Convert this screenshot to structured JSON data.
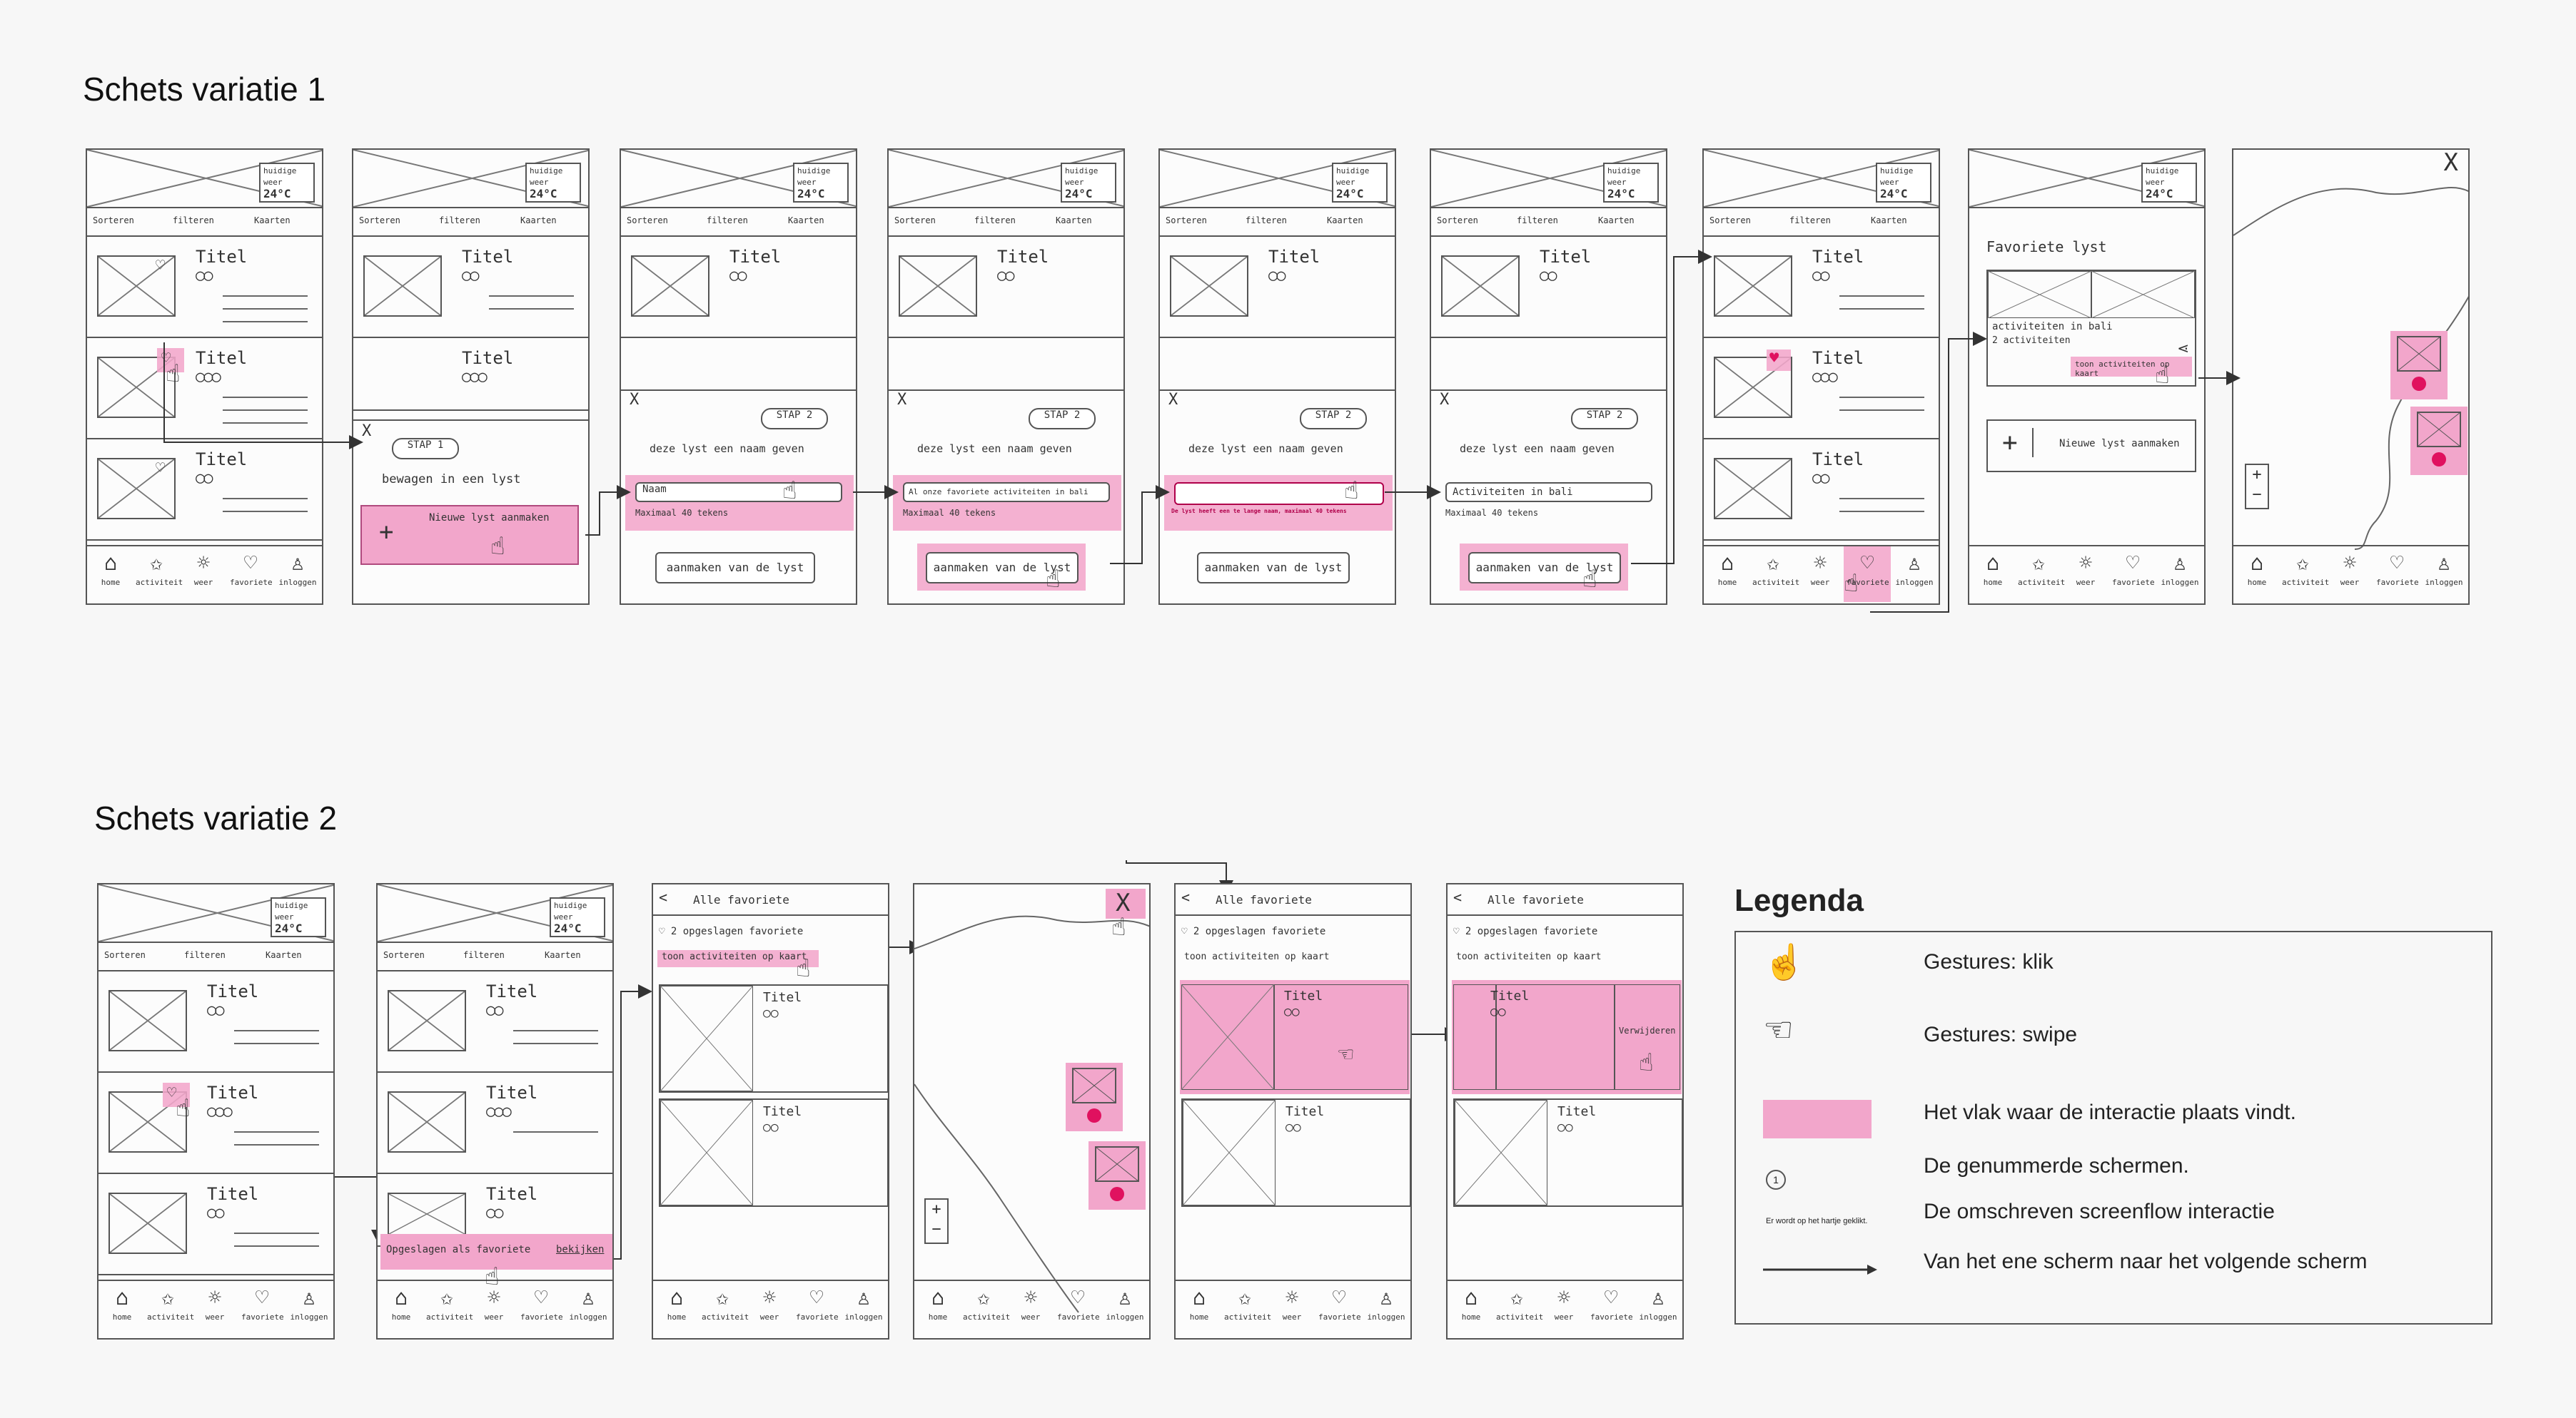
{
  "titles": {
    "variatie1": "Schets variatie 1",
    "variatie2": "Schets variatie 2"
  },
  "common": {
    "weather_label": "huidige weer",
    "weather_temp": "24°C",
    "filter_sort": "Sorteren",
    "filter_filter": "filteren",
    "filter_map": "Kaarten",
    "card_title": "Titel",
    "nav_home": "home",
    "nav_activiteit": "activiteit",
    "nav_weer": "weer",
    "nav_favoriete": "favoriete",
    "nav_inloggen": "inloggen",
    "close": "X",
    "back": "<"
  },
  "v1": {
    "s2_step": "STAP 1",
    "s2_heading": "bewagen in een lyst",
    "s2_new_list": "Nieuwe lyst aanmaken",
    "s3_step": "STAP 2",
    "s3_heading": "deze lyst een naam geven",
    "s3_field": "Naam",
    "s3_hint": "Maximaal 40 tekens",
    "s3_button": "aanmaken van de lyst",
    "s4_field": "Al onze favoriete activiteiten in bali",
    "s5_error": "De lyst heeft een te lange naam, maximaal 40 tekens",
    "s6_field": "Activiteiten in bali",
    "s8_heading": "Favoriete lyst",
    "s8_list_name": "activiteiten in bali",
    "s8_list_count": "2 activiteiten",
    "s8_map_link": "toon activiteiten op kaart",
    "s8_new_list": "Nieuwe lyst aanmaken"
  },
  "v2": {
    "s2_saved": "Opgeslagen als favoriete",
    "s2_view": "bekijken",
    "s3_header": "Alle favoriete",
    "s3_count": "2 opgeslagen favoriete",
    "s3_map_link": "toon activiteiten op kaart",
    "s6_delete": "Verwijderen"
  },
  "legend": {
    "title": "Legenda",
    "click": "Gestures: klik",
    "swipe": "Gestures: swipe",
    "area": "Het vlak waar de interactie plaats vindt.",
    "numbered_sample": "1",
    "numbered": "De genummerde schermen.",
    "described_sample": "Er wordt op het hartje geklikt.",
    "described": "De omschreven screenflow interactie",
    "flow": "Van het ene scherm naar het volgende scherm"
  },
  "colors": {
    "highlight": "#f2a6cb",
    "heart": "#e0115f",
    "line": "#555555"
  }
}
